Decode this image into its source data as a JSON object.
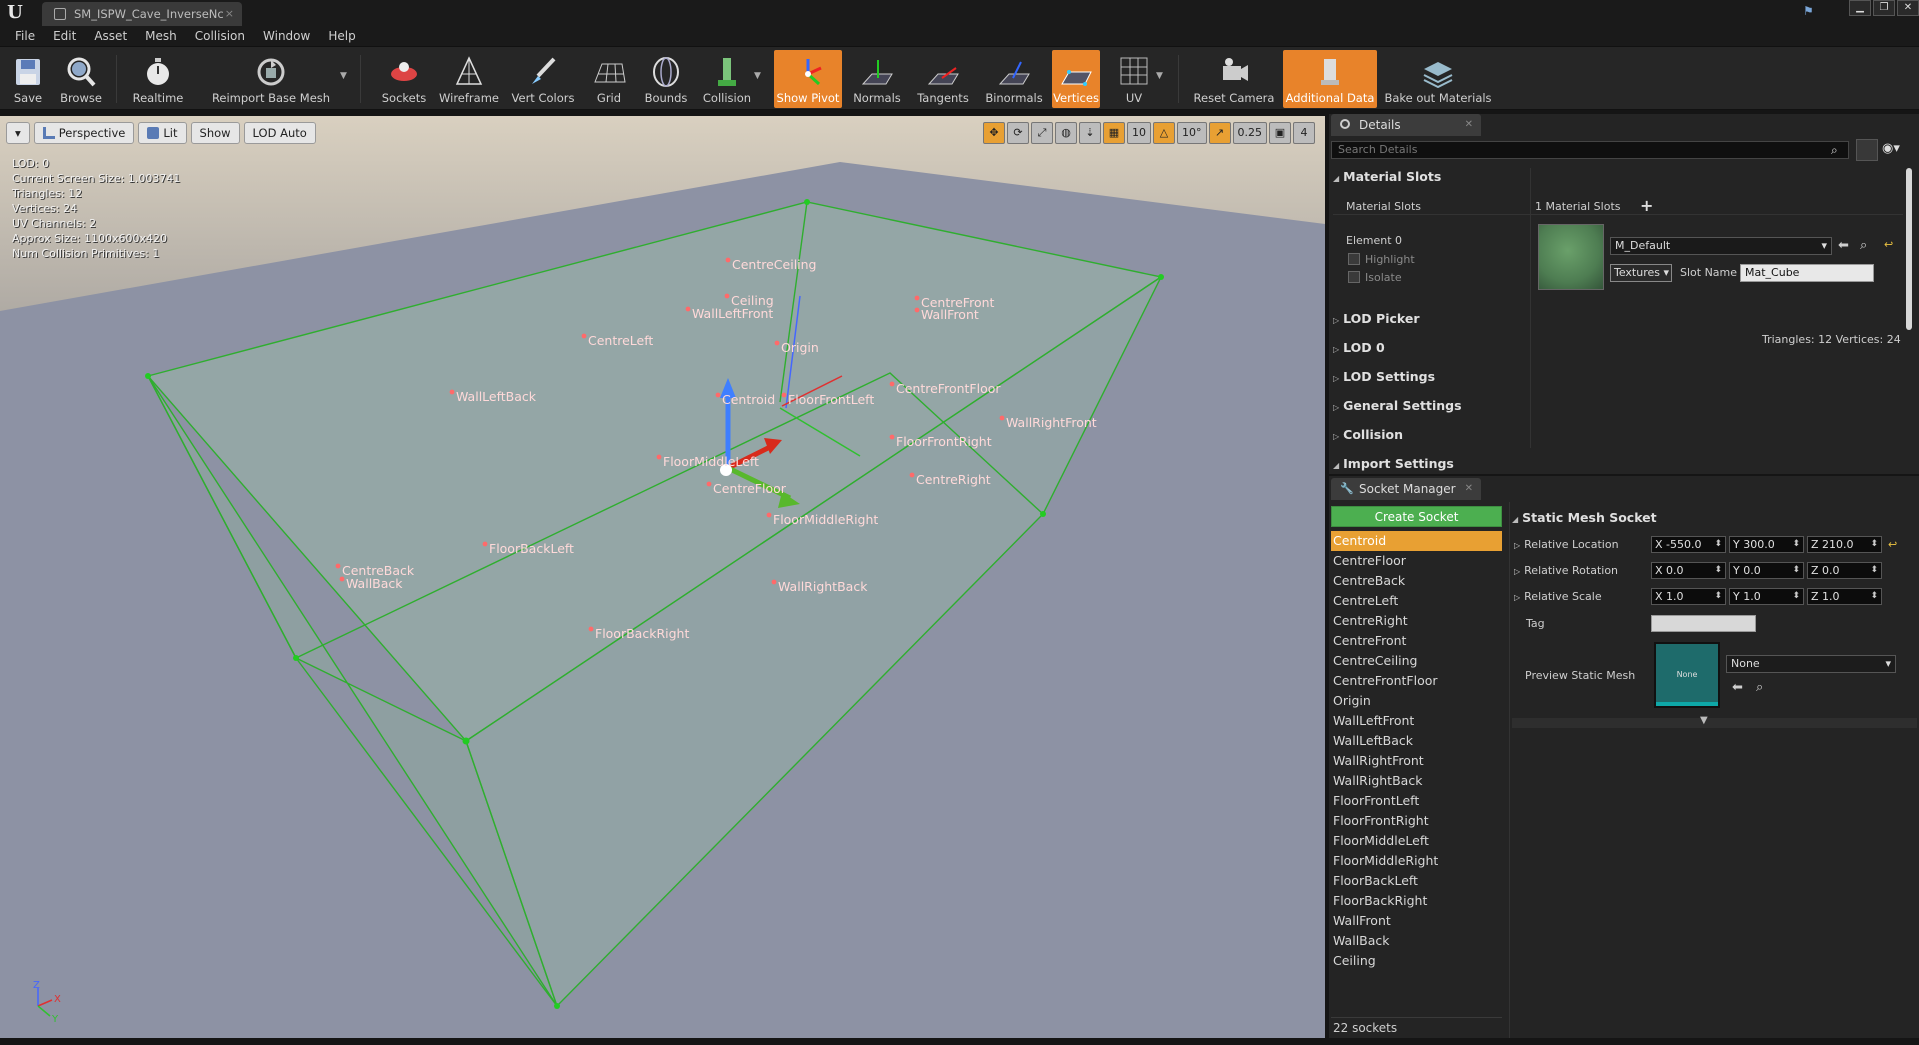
{
  "window": {
    "tab_title": "SM_ISPW_Cave_InverseNc",
    "tab_close": "×",
    "logo": "U",
    "controls": [
      "▁",
      "❐",
      "✕"
    ],
    "help_icon": "help-flag-icon"
  },
  "menu": [
    "File",
    "Edit",
    "Asset",
    "Mesh",
    "Collision",
    "Window",
    "Help"
  ],
  "toolbar": {
    "save": "Save",
    "browse": "Browse",
    "realtime": "Realtime",
    "reimport": "Reimport Base Mesh",
    "sockets": "Sockets",
    "wireframe": "Wireframe",
    "vert_colors": "Vert Colors",
    "grid": "Grid",
    "bounds": "Bounds",
    "collision": "Collision",
    "show_pivot": "Show Pivot",
    "normals": "Normals",
    "tangents": "Tangents",
    "binormals": "Binormals",
    "vertices": "Vertices",
    "uv": "UV",
    "reset_camera": "Reset Camera",
    "additional_data": "Additional Data",
    "bake_out": "Bake out Materials",
    "active_color": "#e8832a"
  },
  "viewport": {
    "perspective": "Perspective",
    "lit": "Lit",
    "show": "Show",
    "lod": "LOD Auto",
    "grid_snap": "10",
    "rot_snap": "10°",
    "scale_snap": "0.25",
    "cam_speed": "4",
    "stats": [
      "LOD:  0",
      "Current Screen Size:  1.003741",
      "Triangles:  12",
      "Vertices:  24",
      "UV Channels:  2",
      "Approx Size: 1100x600x420",
      "Num Collision Primitives:  1"
    ],
    "socket_labels": [
      "CentreCeiling",
      "Ceiling",
      "WallLeftFront",
      "CentreFront",
      "WallFront",
      "CentreLeft",
      "Origin",
      "WallLeftBack",
      "Centroid",
      "FloorFrontLeft",
      "CentreFrontFloor",
      "WallRightFront",
      "FloorFrontRight",
      "FloorMiddleLeft",
      "CentreRight",
      "CentreFloor",
      "FloorMiddleRight",
      "CentreBack",
      "WallBack",
      "FloorBackLeft",
      "WallRightBack",
      "FloorBackRight"
    ],
    "axis": {
      "z": "Z",
      "x": "X",
      "y": "Y"
    }
  },
  "details": {
    "tab": "Details",
    "search_placeholder": "Search Details",
    "material_slots_cat": "Material Slots",
    "material_slots_label": "Material Slots",
    "material_slots_value": "1 Material Slots",
    "add_icon": "+",
    "element": "Element 0",
    "highlight": "Highlight",
    "isolate": "Isolate",
    "material": "M_Default",
    "textures": "Textures",
    "slot_name_label": "Slot Name",
    "slot_name": "Mat_Cube",
    "stats": "Triangles: 12   Vertices: 24",
    "categories": [
      "LOD Picker",
      "LOD 0",
      "LOD Settings",
      "General Settings",
      "Collision",
      "Import Settings"
    ]
  },
  "socket_manager": {
    "tab": "Socket Manager",
    "create": "Create Socket",
    "sockets": [
      "Centroid",
      "CentreFloor",
      "CentreBack",
      "CentreLeft",
      "CentreRight",
      "CentreFront",
      "CentreCeiling",
      "CentreFrontFloor",
      "Origin",
      "WallLeftFront",
      "WallLeftBack",
      "WallRightFront",
      "WallRightBack",
      "FloorFrontLeft",
      "FloorFrontRight",
      "FloorMiddleLeft",
      "FloorMiddleRight",
      "FloorBackLeft",
      "FloorBackRight",
      "WallFront",
      "WallBack",
      "Ceiling"
    ],
    "selected": "Centroid",
    "count": "22 sockets",
    "section": "Static Mesh Socket",
    "relative_location": "Relative Location",
    "relative_rotation": "Relative Rotation",
    "relative_scale": "Relative Scale",
    "tag": "Tag",
    "preview_static_mesh": "Preview Static Mesh",
    "preview_none": "None",
    "preview_combo": "None",
    "location": [
      "X  -550.0",
      "Y  300.0",
      "Z  210.0"
    ],
    "rotation": [
      "X  0.0",
      "Y  0.0",
      "Z  0.0"
    ],
    "scale": [
      "X  1.0",
      "Y  1.0",
      "Z  1.0"
    ]
  }
}
